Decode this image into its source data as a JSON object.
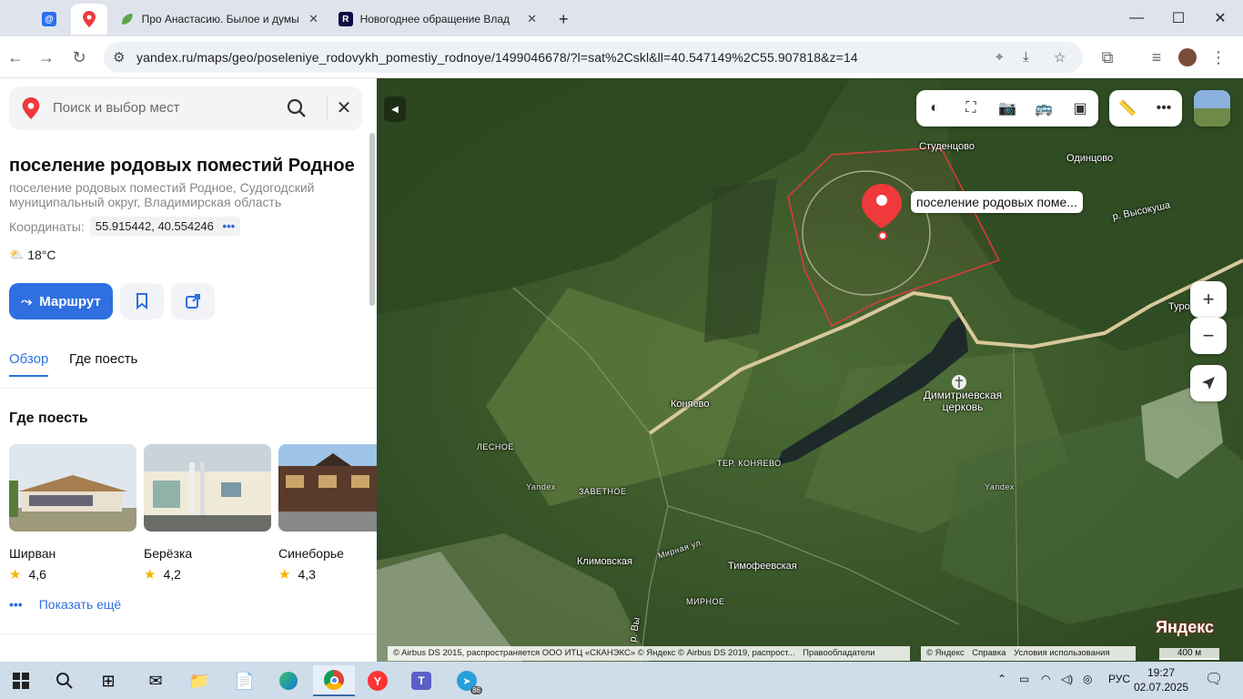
{
  "browser": {
    "tabs": [
      {
        "title": "",
        "icon": "mail-icon",
        "pinned": true
      },
      {
        "title": "",
        "icon": "yandex-maps-icon",
        "pinned": true,
        "active": true
      },
      {
        "title": "Про Анастасию. Былое и думы",
        "icon": "leaf-icon"
      },
      {
        "title": "Новогоднее обращение Влад",
        "icon": "rutube-icon"
      }
    ],
    "new_tab": "+",
    "url": "yandex.ru/maps/geo/poseleniye_rodovykh_pomestiy_rodnoye/1499046678/?l=sat%2Cskl&ll=40.547149%2C55.907818&z=14"
  },
  "panel": {
    "search_placeholder": "Поиск и выбор мест",
    "title": "поселение родовых поместий Родное",
    "subtitle": "поселение родовых поместий Родное, Судогодский муниципальный округ, Владимирская область",
    "coords_label": "Координаты:",
    "coords_value": "55.915442, 40.554246",
    "weather": "18°C",
    "route_label": "Маршрут",
    "tabs": [
      "Обзор",
      "Где поесть"
    ],
    "section_title": "Где поесть",
    "places": [
      {
        "name": "Ширван",
        "rating": "4,6"
      },
      {
        "name": "Берёзка",
        "rating": "4,2"
      },
      {
        "name": "Синеборье",
        "rating": "4,3"
      }
    ],
    "show_more": "Показать ещё"
  },
  "map": {
    "place_label": "поселение родовых поме...",
    "labels": {
      "studentsovo": "Студенцово",
      "odintsovo": "Одинцово",
      "vysokusha": "р. Высокуша",
      "turo": "Туро",
      "konyaevo": "Коняево",
      "church": "Димитриевская церковь",
      "lesnoe": "ЛЕСНОЕ",
      "ter_konyaevo": "ТЕР. КОНЯЕВО",
      "zavetnoe": "ЗАВЕТНОЕ",
      "yandex1": "Yandex",
      "yandex2": "Yandex",
      "klimovskaya": "Климовская",
      "mirnaya": "Мирная ул.",
      "timofeevskaya": "Тимофеевская",
      "mirnoe": "МИРНОЕ",
      "river_v": "р. Вы"
    },
    "copyright_1": "© Airbus DS 2015, распространяется ООО ИТЦ «СКАНЭКС» © Яндекс © Airbus DS 2019, распрост...",
    "rights_holders": "Правообладатели",
    "copyright_2": "© Яндекс",
    "help": "Справка",
    "terms": "Условия использования",
    "logo": "Яндекс",
    "scale": "400 м"
  },
  "taskbar": {
    "lang": "РУС",
    "time": "19:27",
    "date": "02.07.2025",
    "telegram_badge": "86"
  },
  "colors": {
    "accent": "#2f6fe0",
    "pin": "#f0393b",
    "boundary": "#e03a3a"
  }
}
